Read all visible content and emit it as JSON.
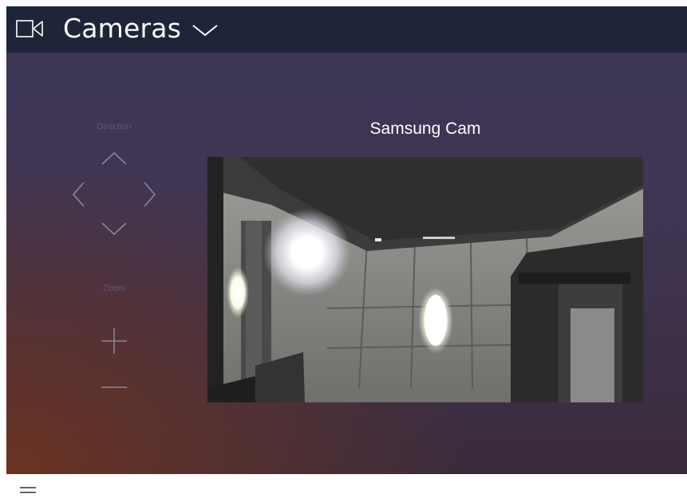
{
  "header": {
    "title": "Cameras",
    "icon": "video-camera-icon",
    "dropdown_icon": "chevron-down-icon"
  },
  "controls": {
    "direction_label": "Direction",
    "zoom_label": "Zoom",
    "icons": [
      "chevron-up-icon",
      "chevron-left-icon",
      "chevron-right-icon",
      "chevron-down-icon",
      "plus-icon",
      "minus-icon"
    ]
  },
  "camera": {
    "name": "Samsung Cam"
  },
  "footer": {
    "menu_icon": "hamburger-menu-icon"
  },
  "colors": {
    "topbar": "#1f2539",
    "background": "#3e3656",
    "control_stroke": "#8a8497",
    "label": "#5f5874"
  }
}
